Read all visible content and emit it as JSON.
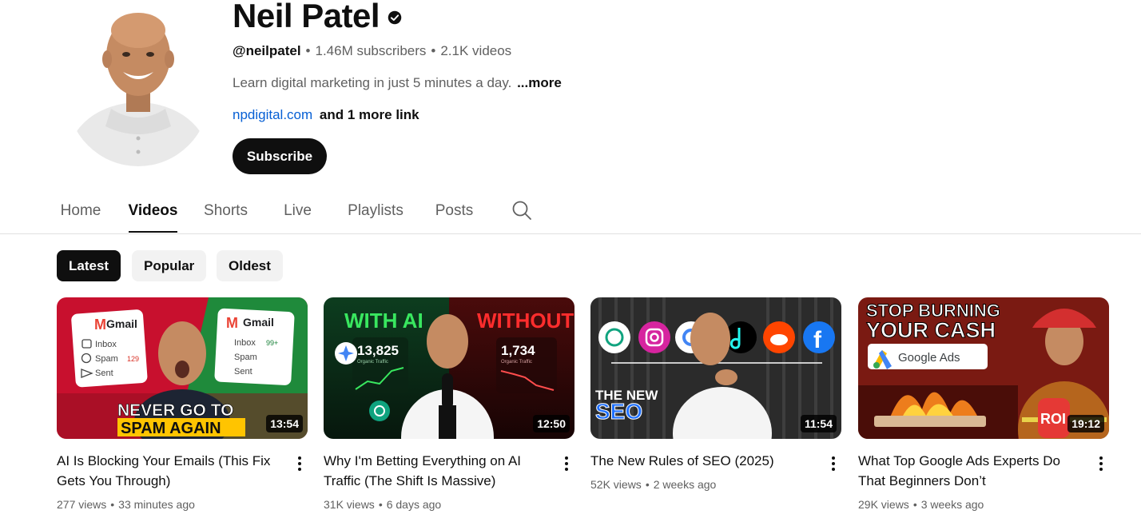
{
  "channel": {
    "name": "Neil Patel",
    "handle": "@neilpatel",
    "subscribers": "1.46M subscribers",
    "videos_count": "2.1K videos",
    "meta_separator": "•",
    "description": "Learn digital marketing in just 5 minutes a day.",
    "description_more": "...more",
    "link": "npdigital.com",
    "more_links": "and 1 more link",
    "subscribe_label": "Subscribe"
  },
  "tabs": [
    {
      "label": "Home",
      "active": false
    },
    {
      "label": "Videos",
      "active": true
    },
    {
      "label": "Shorts",
      "active": false
    },
    {
      "label": "Live",
      "active": false
    },
    {
      "label": "Playlists",
      "active": false
    },
    {
      "label": "Posts",
      "active": false
    }
  ],
  "chips": [
    {
      "label": "Latest",
      "active": true
    },
    {
      "label": "Popular",
      "active": false
    },
    {
      "label": "Oldest",
      "active": false
    }
  ],
  "videos": [
    {
      "title": "AI Is Blocking Your Emails (This Fix Gets You Through)",
      "views": "277 views",
      "age": "33 minutes ago",
      "duration": "13:54",
      "thumb_text": {
        "gmail_1": "Gmail",
        "gmail_2": "Gmail",
        "inbox_1": "Inbox",
        "spam_1": "Spam",
        "spam_count": "129",
        "sent_1": "Sent",
        "inbox_2": "Inbox",
        "inbox_count": "99+",
        "spam_2": "Spam",
        "sent_2": "Sent",
        "line_1": "NEVER GO TO",
        "line_2": "SPAM AGAIN"
      }
    },
    {
      "title": "Why I'm Betting Everything on AI Traffic (The Shift Is Massive)",
      "views": "31K views",
      "age": "6 days ago",
      "duration": "12:50",
      "thumb_text": {
        "left_label": "WITH AI",
        "right_label": "WITHOUT",
        "left_value": "13,825",
        "right_value": "1,734",
        "caption": "Organic Traffic"
      }
    },
    {
      "title": "The New Rules of SEO (2025)",
      "views": "52K views",
      "age": "2 weeks ago",
      "duration": "11:54",
      "thumb_text": {
        "line_1": "THE NEW",
        "line_2": "SEO"
      }
    },
    {
      "title": "What Top Google Ads Experts Do That Beginners Don’t",
      "views": "29K views",
      "age": "3 weeks ago",
      "duration": "19:12",
      "thumb_text": {
        "line_1": "STOP BURNING",
        "line_2": "YOUR CASH",
        "badge": "Google Ads",
        "roi": "ROI"
      }
    }
  ],
  "icons": {
    "verified": "verified-check-icon",
    "search": "search-icon",
    "more": "more-vert-icon"
  },
  "colors": {
    "link": "#065fd4",
    "primary_text": "#0f0f0f",
    "secondary_text": "#606060",
    "chip_bg": "#f2f2f2"
  }
}
